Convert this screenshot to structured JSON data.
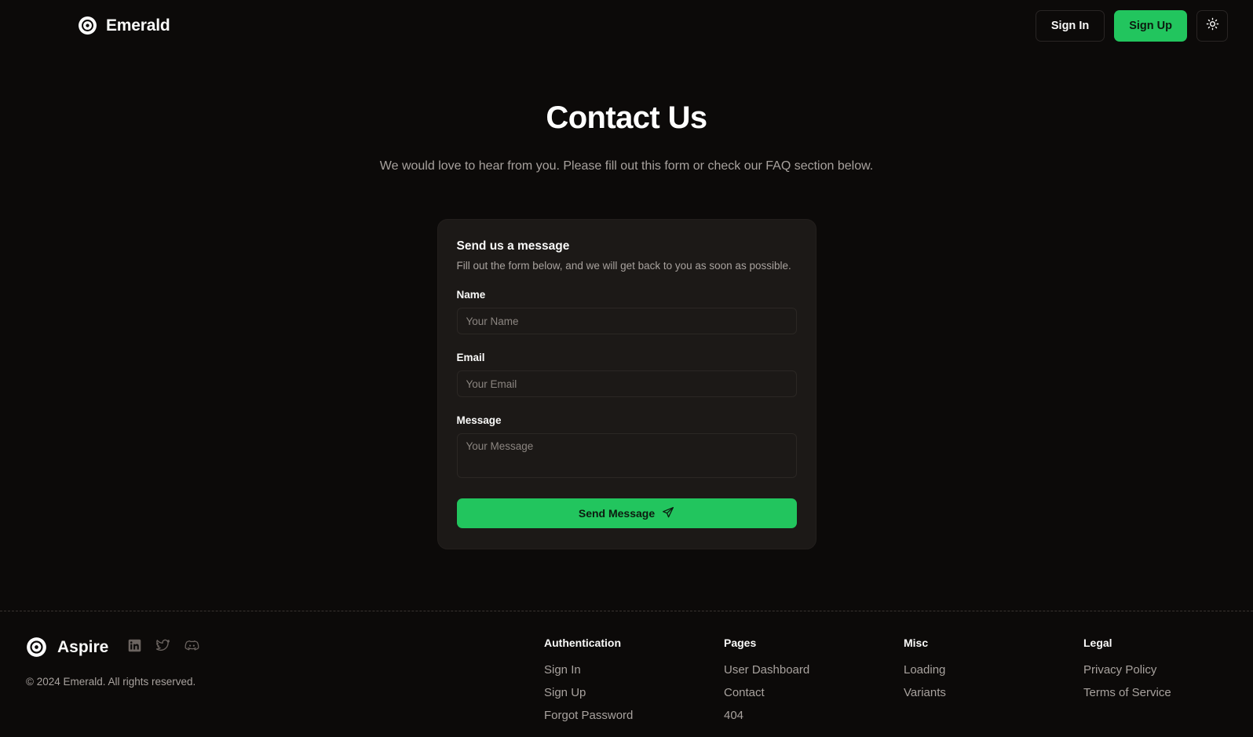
{
  "theme": {
    "page_bg": "#0c0a09",
    "card_bg": "#1c1917",
    "accent": "#22c55e",
    "text_primary": "#fafaf9",
    "text_muted": "#a8a29e"
  },
  "header": {
    "brand_name": "Emerald",
    "brand_icon": "disc-target-icon",
    "sign_in_label": "Sign In",
    "sign_up_label": "Sign Up",
    "theme_toggle_icon": "sun-icon"
  },
  "hero": {
    "title": "Contact Us",
    "subtitle": "We would love to hear from you. Please fill out this form or check our FAQ section below."
  },
  "form_card": {
    "title": "Send us a message",
    "subtitle": "Fill out the form below, and we will get back to you as soon as possible.",
    "fields": [
      {
        "label": "Name",
        "placeholder": "Your Name",
        "value": ""
      },
      {
        "label": "Email",
        "placeholder": "Your Email",
        "value": ""
      },
      {
        "label": "Message",
        "placeholder": "Your Message",
        "value": ""
      }
    ],
    "submit_label": "Send Message",
    "submit_icon": "send-paper-plane-icon"
  },
  "footer": {
    "brand_name": "Aspire",
    "brand_icon": "disc-target-icon",
    "socials": [
      {
        "name": "linkedin-icon"
      },
      {
        "name": "twitter-icon"
      },
      {
        "name": "discord-icon"
      }
    ],
    "copyright": "© 2024 Emerald. All rights reserved.",
    "columns": [
      {
        "title": "Authentication",
        "links": [
          "Sign In",
          "Sign Up",
          "Forgot Password"
        ]
      },
      {
        "title": "Pages",
        "links": [
          "User Dashboard",
          "Contact",
          "404"
        ]
      },
      {
        "title": "Misc",
        "links": [
          "Loading",
          "Variants"
        ]
      },
      {
        "title": "Legal",
        "links": [
          "Privacy Policy",
          "Terms of Service"
        ]
      }
    ]
  }
}
